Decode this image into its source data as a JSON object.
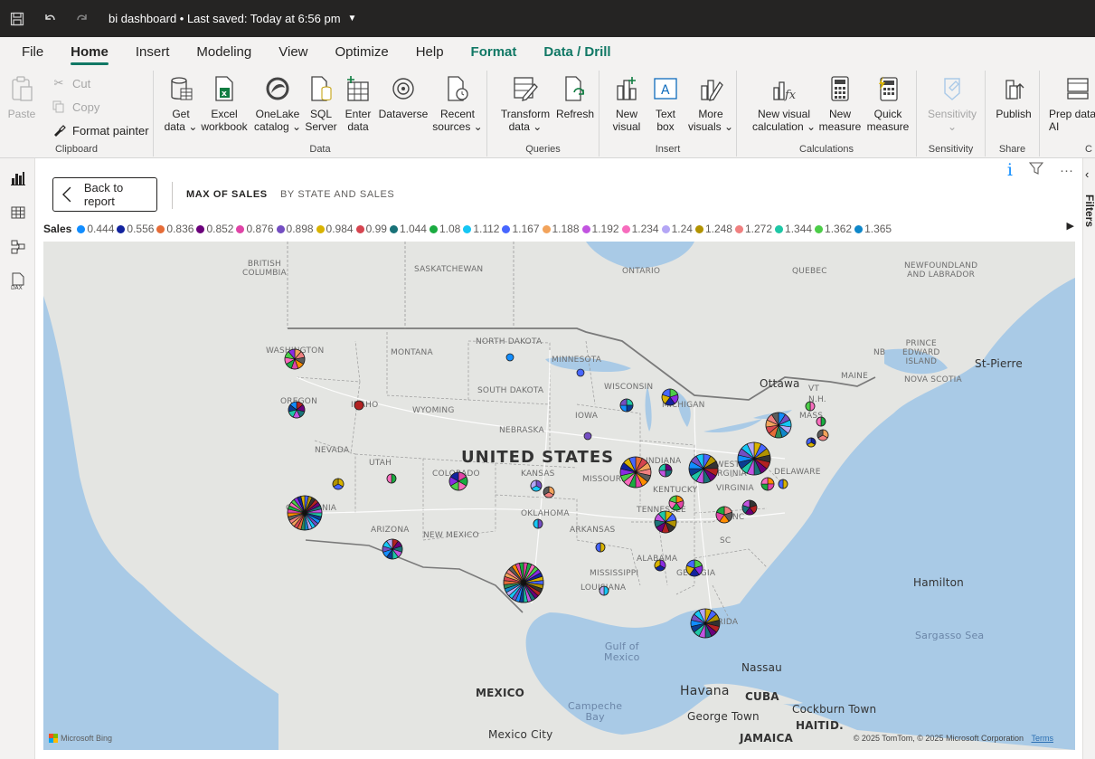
{
  "titlebar": {
    "title": "bi dashboard • Last saved: Today at 6:56 pm"
  },
  "menu": {
    "tabs": [
      {
        "label": "File",
        "state": "normal"
      },
      {
        "label": "Home",
        "state": "active"
      },
      {
        "label": "Insert",
        "state": "normal"
      },
      {
        "label": "Modeling",
        "state": "normal"
      },
      {
        "label": "View",
        "state": "normal"
      },
      {
        "label": "Optimize",
        "state": "normal"
      },
      {
        "label": "Help",
        "state": "normal"
      },
      {
        "label": "Format",
        "state": "context"
      },
      {
        "label": "Data / Drill",
        "state": "context"
      }
    ]
  },
  "ribbon": {
    "clipboard": {
      "label": "Clipboard",
      "paste": "Paste",
      "cut": "Cut",
      "copy": "Copy",
      "format_painter": "Format painter"
    },
    "data": {
      "label": "Data",
      "get_data": "Get\ndata ⌄",
      "excel": "Excel\nworkbook",
      "onelake": "OneLake\ncatalog ⌄",
      "sql": "SQL\nServer",
      "enter_data": "Enter\ndata",
      "dataverse": "Dataverse",
      "recent": "Recent\nsources ⌄"
    },
    "queries": {
      "label": "Queries",
      "transform": "Transform\ndata ⌄",
      "refresh": "Refresh"
    },
    "insert": {
      "label": "Insert",
      "new_visual": "New\nvisual",
      "text_box": "Text\nbox",
      "more_visuals": "More\nvisuals ⌄"
    },
    "calculations": {
      "label": "Calculations",
      "new_visual_calc": "New visual\ncalculation ⌄",
      "new_measure": "New\nmeasure",
      "quick_measure": "Quick\nmeasure"
    },
    "sensitivity": {
      "label": "Sensitivity",
      "btn": "Sensitivity\n⌄"
    },
    "share": {
      "label": "Share",
      "publish": "Publish"
    },
    "copilot": {
      "label": "C",
      "prep": "Prep data\nAI"
    }
  },
  "rightpanel": {
    "label": "Filters"
  },
  "visual": {
    "back_label": "Back to report",
    "drill_tabs": [
      "MAX OF SALES",
      "BY STATE AND SALES"
    ],
    "legend_title": "Sales",
    "legend": [
      {
        "label": "0.444",
        "color": "#118dff"
      },
      {
        "label": "0.556",
        "color": "#12239e"
      },
      {
        "label": "0.836",
        "color": "#e66c37"
      },
      {
        "label": "0.852",
        "color": "#6b007b"
      },
      {
        "label": "0.876",
        "color": "#e044a7"
      },
      {
        "label": "0.898",
        "color": "#744ec2"
      },
      {
        "label": "0.984",
        "color": "#d9b300"
      },
      {
        "label": "0.99",
        "color": "#d64550"
      },
      {
        "label": "1.044",
        "color": "#197278"
      },
      {
        "label": "1.08",
        "color": "#1aab40"
      },
      {
        "label": "1.112",
        "color": "#15c6f4"
      },
      {
        "label": "1.167",
        "color": "#4766ff"
      },
      {
        "label": "1.188",
        "color": "#f2a35b"
      },
      {
        "label": "1.192",
        "color": "#c254e0"
      },
      {
        "label": "1.234",
        "color": "#f76cbd"
      },
      {
        "label": "1.24",
        "color": "#b4a6f5"
      },
      {
        "label": "1.248",
        "color": "#b29300"
      },
      {
        "label": "1.272",
        "color": "#f08080"
      },
      {
        "label": "1.344",
        "color": "#1ec7a6"
      },
      {
        "label": "1.362",
        "color": "#4ccd48"
      },
      {
        "label": "1.365",
        "color": "#0f87c9"
      }
    ]
  },
  "map": {
    "labels": {
      "british_columbia": "BRITISH\nCOLUMBIA",
      "saskatchewan": "SASKATCHEWAN",
      "ontario": "ONTARIO",
      "quebec": "QUEBEC",
      "newfoundland": "NEWFOUNDLAND\nAND LABRADOR",
      "pei": "PRINCE\nEDWARD\nISLAND",
      "nb": "NB",
      "st_pierre": "St-Pierre",
      "nova_scotia": "NOVA SCOTIA",
      "maine": "MAINE",
      "ottawa": "Ottawa",
      "vt": "VT",
      "nh": "N.H.",
      "mass": "MASS",
      "washington": "WASHINGTON",
      "montana": "MONTANA",
      "north_dakota": "NORTH DAKOTA",
      "minnesota": "MINNESOTA",
      "oregon": "OREGON",
      "idaho": "IDAHO",
      "wyoming": "WYOMING",
      "south_dakota": "SOUTH DAKOTA",
      "wisconsin": "WISCONSIN",
      "michigan": "MICHIGAN",
      "iowa": "IOWA",
      "nebraska": "NEBRASKA",
      "nevada": "NEVADA",
      "utah": "UTAH",
      "colorado": "COLORADO",
      "kansas": "KANSAS",
      "missouri": "MISSOURI",
      "indiana": "INDIANA",
      "west_virginia": "WEST\nVIRGINIA",
      "virginia": "VIRGINIA",
      "kentucky": "KENTUCKY",
      "md": "MD",
      "delaware": "DELAWARE",
      "california": "CALIFORNIA",
      "arizona": "ARIZONA",
      "new_mexico": "NEW MEXICO",
      "oklahoma": "OKLAHOMA",
      "arkansas": "ARKANSAS",
      "tennessee": "TENNESSEE",
      "nc": "NC",
      "sc": "SC",
      "mississippi": "MISSISSIPPI",
      "alabama": "ALABAMA",
      "georgia": "GEORGIA",
      "louisiana": "LOUISIANA",
      "florida": "FLORIDA",
      "united_states": "UNITED STATES",
      "gulf": "Gulf of\nMexico",
      "mexico": "MEXICO",
      "campeche": "Campeche\nBay",
      "mexico_city": "Mexico City",
      "havana": "Havana",
      "cuba": "CUBA",
      "nassau": "Nassau",
      "hamilton": "Hamilton",
      "sargasso": "Sargasso Sea",
      "george_town": "George Town",
      "cockburn": "Cockburn Town",
      "jamaica": "JAMAICA",
      "haiti": "HAITI",
      "d": "D."
    },
    "attribution_left": "Microsoft Bing",
    "attribution_right": "© 2025 TomTom, © 2025 Microsoft Corporation",
    "terms": "Terms"
  }
}
